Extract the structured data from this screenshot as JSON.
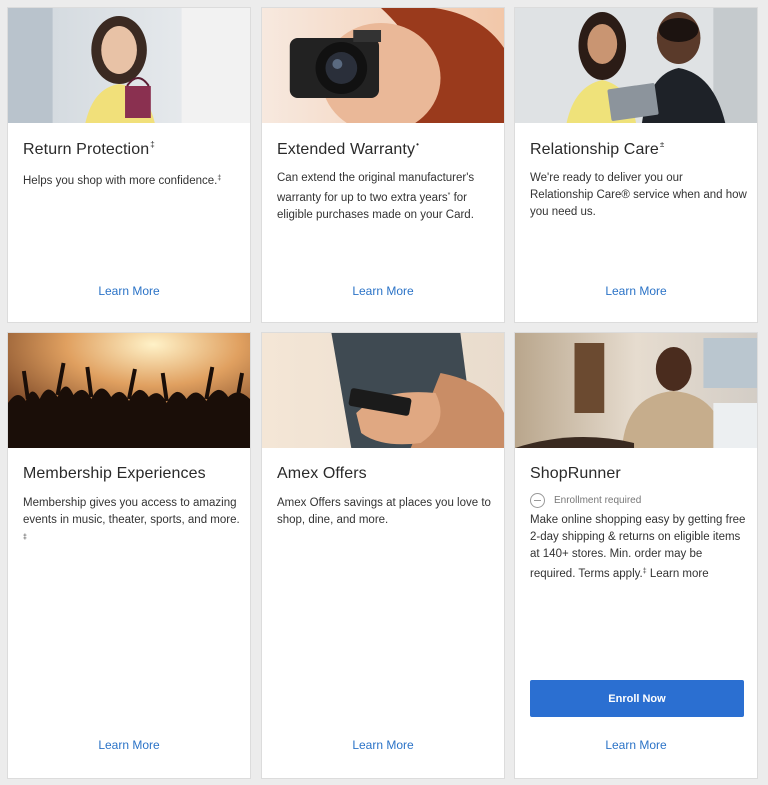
{
  "cards": [
    {
      "title": "Return Protection",
      "title_mark": "‡",
      "description": "Helps you shop with more confidence.",
      "description_mark": "‡",
      "link": "Learn More",
      "image": "woman-with-shopping-bag"
    },
    {
      "title": "Extended Warranty",
      "title_mark": "•",
      "description_pre": "Can extend the original manufacturer's warranty for up to two extra years",
      "description_mark": "*",
      "description_post": " for eligible purchases made on your Card.",
      "link": "Learn More",
      "image": "woman-with-camera"
    },
    {
      "title": "Relationship Care",
      "title_mark": "±",
      "description": "We're ready to deliver you our Relationship Care® service when and how you need us.",
      "link": "Learn More",
      "image": "two-people-with-tablet"
    },
    {
      "title": "Membership Experiences",
      "description": "Membership gives you access to amazing events in music, theater, sports, and more. ",
      "description_mark": "‡",
      "link": "Learn More",
      "image": "concert-crowd"
    },
    {
      "title": "Amex Offers",
      "description": "Amex Offers savings at places you love to shop, dine, and more.",
      "link": "Learn More",
      "image": "hand-holding-phone"
    },
    {
      "title": "ShopRunner",
      "status": "Enrollment required",
      "description_pre": "Make online shopping easy by getting free 2-day shipping & returns on eligible items at 140+ stores. Min. order may be required. Terms apply.",
      "description_mark": "‡",
      "description_post": " Learn more",
      "button": "Enroll Now",
      "link": "Learn More",
      "image": "man-at-laptop"
    }
  ],
  "colors": {
    "link": "#2b73c7",
    "button": "#2b6fd1",
    "background": "#ececec"
  }
}
